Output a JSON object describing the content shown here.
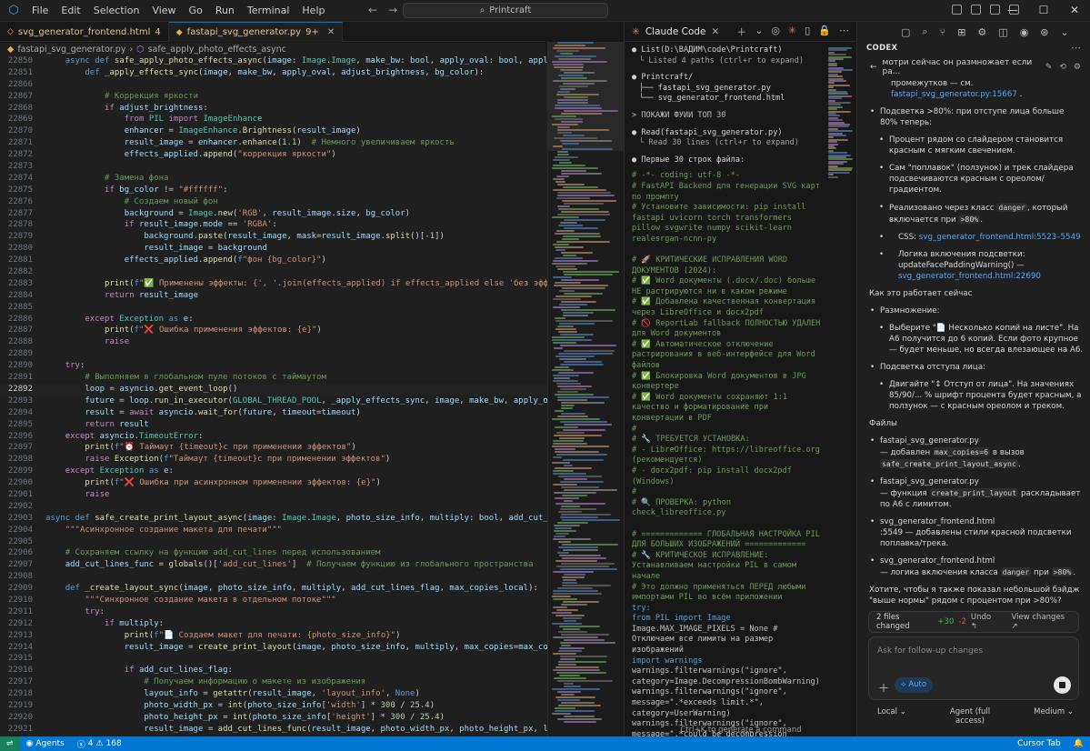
{
  "titlebar": {
    "menu": [
      "File",
      "Edit",
      "Selection",
      "View",
      "Go",
      "Run",
      "Terminal",
      "Help"
    ],
    "search": "Printcraft"
  },
  "editor": {
    "tabs": [
      {
        "label": "svg_generator_frontend.html",
        "badge": "4",
        "active": false
      },
      {
        "label": "fastapi_svg_generator.py",
        "badge": "9+",
        "active": true
      }
    ],
    "breadcrumb": {
      "file": "fastapi_svg_generator.py",
      "symbol": "safe_apply_photo_effects_async"
    }
  },
  "code_lines": [
    {
      "n": "22850",
      "t": "    async def safe_apply_photo_effects_async(image: Image.Image, make_bw: bool, apply_oval: bool, apply_b"
    },
    {
      "n": "22851",
      "t": "        def _apply_effects_sync(image, make_bw, apply_oval, adjust_brightness, bg_color):"
    },
    {
      "n": "22866",
      "t": ""
    },
    {
      "n": "22867",
      "t": "            # Коррекция яркости"
    },
    {
      "n": "22868",
      "t": "            if adjust_brightness:"
    },
    {
      "n": "22869",
      "t": "                from PIL import ImageEnhance"
    },
    {
      "n": "22870",
      "t": "                enhancer = ImageEnhance.Brightness(result_image)"
    },
    {
      "n": "22871",
      "t": "                result_image = enhancer.enhance(1.1)  # Немного увеличиваем яркость"
    },
    {
      "n": "22872",
      "t": "                effects_applied.append(\"коррекция яркости\")"
    },
    {
      "n": "22873",
      "t": ""
    },
    {
      "n": "22874",
      "t": "            # Замена фона"
    },
    {
      "n": "22875",
      "t": "            if bg_color != \"#ffffff\":"
    },
    {
      "n": "22876",
      "t": "                # Создаем новый фон"
    },
    {
      "n": "22877",
      "t": "                background = Image.new('RGB', result_image.size, bg_color)"
    },
    {
      "n": "22878",
      "t": "                if result_image.mode == 'RGBA':"
    },
    {
      "n": "22879",
      "t": "                    background.paste(result_image, mask=result_image.split()[-1])"
    },
    {
      "n": "22880",
      "t": "                    result_image = background"
    },
    {
      "n": "22881",
      "t": "                effects_applied.append(f\"фон {bg_color}\")"
    },
    {
      "n": "22882",
      "t": ""
    },
    {
      "n": "22883",
      "t": "            print(f\"✅ Применены эффекты: {', '.join(effects_applied) if effects_applied else 'без эффект"
    },
    {
      "n": "22884",
      "t": "            return result_image"
    },
    {
      "n": "22885",
      "t": ""
    },
    {
      "n": "22886",
      "t": "        except Exception as e:"
    },
    {
      "n": "22887",
      "t": "            print(f\"❌ Ошибка применения эффектов: {e}\")"
    },
    {
      "n": "22888",
      "t": "            raise"
    },
    {
      "n": "22889",
      "t": ""
    },
    {
      "n": "22890",
      "t": "    try:"
    },
    {
      "n": "22891",
      "t": "        # Выполняем в глобальном пуле потоков с таймаутом"
    },
    {
      "n": "22892",
      "t": "        loop = asyncio.get_event_loop()"
    },
    {
      "n": "22893",
      "t": "        future = loop.run_in_executor(GLOBAL_THREAD_POOL, _apply_effects_sync, image, make_bw, apply_ov"
    },
    {
      "n": "22894",
      "t": "        result = await asyncio.wait_for(future, timeout=timeout)"
    },
    {
      "n": "22895",
      "t": "        return result"
    },
    {
      "n": "22896",
      "t": "    except asyncio.TimeoutError:"
    },
    {
      "n": "22897",
      "t": "        print(f\"⏰ Таймаут {timeout}с при применении эффектов\")"
    },
    {
      "n": "22898",
      "t": "        raise Exception(f\"Таймаут {timeout}с при применении эффектов\")"
    },
    {
      "n": "22899",
      "t": "    except Exception as e:"
    },
    {
      "n": "22900",
      "t": "        print(f\"❌ Ошибка при асинхронном применении эффектов: {e}\")"
    },
    {
      "n": "22901",
      "t": "        raise"
    },
    {
      "n": "22902",
      "t": ""
    },
    {
      "n": "22903",
      "t": "async def safe_create_print_layout_async(image: Image.Image, photo_size_info, multiply: bool, add_cut_lin"
    },
    {
      "n": "22904",
      "t": "    \"\"\"Асинхронное создание макета для печати\"\"\""
    },
    {
      "n": "22905",
      "t": ""
    },
    {
      "n": "22906",
      "t": "    # Сохраняем ссылку на функцию add_cut_lines перед использованием"
    },
    {
      "n": "22907",
      "t": "    add_cut_lines_func = globals()['add_cut_lines']  # Получаем функцию из глобального пространства"
    },
    {
      "n": "22908",
      "t": ""
    },
    {
      "n": "22909",
      "t": "    def _create_layout_sync(image, photo_size_info, multiply, add_cut_lines_flag, max_copies_local):"
    },
    {
      "n": "22910",
      "t": "        \"\"\"Синхронное создание макета в отдельном потоке\"\"\""
    },
    {
      "n": "22911",
      "t": "        try:"
    },
    {
      "n": "22912",
      "t": "            if multiply:"
    },
    {
      "n": "22913",
      "t": "                print(f\"📄 Создаем макет для печати: {photo_size_info}\")"
    },
    {
      "n": "22914",
      "t": "                result_image = create_print_layout(image, photo_size_info, multiply, max_copies=max_copie"
    },
    {
      "n": "22915",
      "t": ""
    },
    {
      "n": "22916",
      "t": "                if add_cut_lines_flag:"
    },
    {
      "n": "22917",
      "t": "                    # Получаем информацию о макете из изображения"
    },
    {
      "n": "22918",
      "t": "                    layout_info = getattr(result_image, 'layout_info', None)"
    },
    {
      "n": "22919",
      "t": "                    photo_width_px = int(photo_size_info['width'] * 300 / 25.4)"
    },
    {
      "n": "22920",
      "t": "                    photo_height_px = int(photo_size_info['height'] * 300 / 25.4)"
    },
    {
      "n": "22921",
      "t": "                    result_image = add_cut_lines_func(result_image, photo_width_px, photo_height_px, layou"
    },
    {
      "n": "22922",
      "t": "                    "
    }
  ],
  "current_line": "22892",
  "claude": {
    "title": "Claude Code",
    "list_cmd": "List(D:\\ВАДИМ\\code\\Printcraft)",
    "list_result": "Listed 4 paths (ctrl+r to expand)",
    "tree": [
      "Printcraft/",
      "├── fastapi_svg_generator.py",
      "└── svg_generator_frontend.html"
    ],
    "prompt": "> ПОКАЖИ ФУИИ ТОП 30",
    "read_cmd": "Read(fastapi_svg_generator.py)",
    "read_result": "Read 30 lines (ctrl+r to expand)",
    "first_lines": "Первые 30 строк файла:",
    "code": [
      "# -*- coding: utf-8 -*-",
      "# FastAPI Backend для генерации SVG карт по промпту",
      "# Установите зависимости: pip install fastapi uvicorn torch transformers pillow svgwrite numpy scikit-learn realesrgan-ncnn-py",
      "",
      "# 🚀 КРИТИЧЕСКИЕ ИСПРАВЛЕНИЯ WORD ДОКУМЕНТОВ (2024):",
      "# ✅ Word документы (.docx/.doc) больше НЕ растрируются ни в каком режиме",
      "# ✅ Добавлена качественная конвертация через LibreOffice и docx2pdf",
      "# 🚫 ReportLab fallback ПОЛНОСТЬЮ УДАЛЕН для Word документов",
      "# ✅ Автоматическое отключение растрирования в веб-интерфейсе для Word файлов",
      "# ✅ Блокировка Word документов в JPG конвертере",
      "# ✅ Word документы сохраняют 1:1 качество и форматирование при конвертации в PDF",
      "#",
      "# 🔧 ТРЕБУЕТСЯ УСТАНОВКА:",
      "# - LibreOffice: https://libreoffice.org (рекомендуется)",
      "# - docx2pdf: pip install docx2pdf (Windows)",
      "#",
      "# 🔍 ПРОВЕРКА: python check_libreoffice.py",
      "",
      "# ============= ГЛОБАЛЬНАЯ НАСТРОЙКА PIL ДЛЯ БОЛЬШИХ ИЗОБРАЖЕНИЙ =============",
      "# 🔧 КРИТИЧЕСКОЕ ИСПРАВЛЕНИЕ: Устанавливаем настройки PIL в самом начале",
      "# Это должно применяться ПЕРЕД любыми импортами PIL во всём приложении",
      "try:",
      "    from PIL import Image",
      "    Image.MAX_IMAGE_PIXELS = None  # Отключаем все лимиты на размер изображений",
      "    import warnings",
      "    warnings.filterwarnings(\"ignore\", category=Image.DecompressionBombWarning)",
      "    warnings.filterwarnings(\"ignore\", message=\".*exceeds limit.*\", category=UserWarning)",
      "    warnings.filterwarnings(\"ignore\", message=\".*could be decompression bomb.*\", category=UserWarning)"
    ],
    "hint": "Ctrl+K to generate a command"
  },
  "codex": {
    "title": "CODEX",
    "thread": "мотри сейчас он размножает если ра...",
    "intro1": "промежутков — см.",
    "intro1_link": "fastapi_svg_generator.py:15667",
    "b1": "Подсветка >80%: при отступе лица больше 80% теперь:",
    "b1a": "Процент рядом со слайдером становится красным с мягким свечением.",
    "b1b": "Сам \"поплавок\" (ползунок) и трек слайдера подсвечиваются красным с ореолом/градиентом.",
    "b1c_pre": "Реализовано через класс",
    "b1c_code": "danger",
    "b1c_mid": ", который включается при",
    "b1c_code2": ">80%",
    "b1d_pre": "CSS:",
    "b1d_link": "svg_generator_frontend.html:5523–5549",
    "b1e_pre": "Логика включения подсветки:",
    "b1e_code": "updateFacePaddingWarning()",
    "b1e_link": "svg_generator_frontend.html:22690",
    "how": "Как это работает сейчас",
    "m1": "Размножение:",
    "m1a": "Выберите \"📄 Несколько копий на листе\". На А6 получится до 6 копий. Если фото крупное — будет меньше, но всегда влезающее на А6.",
    "m2": "Подсветка отступа лица:",
    "m2a": "Двигайте \"↕ Отступ от лица\". На значениях 85/90/... % шрифт процента будет красным, а ползунок — с красным ореолом и треком.",
    "files": "Файлы",
    "f1": "fastapi_svg_generator.py",
    "f1d_pre": "— добавлен",
    "f1d_code": "max_copies=6",
    "f1d_mid": "в вызов",
    "f1d_code2": "safe_create_print_layout_async",
    "f2": "fastapi_svg_generator.py",
    "f2d_pre": "— функция",
    "f2d_code": "create_print_layout",
    "f2d_post": "раскладывает по А6 с лимитом.",
    "f3": "svg_generator_frontend.html",
    "f3d": ":5549 — добавлены стили красной подсветки поплавка/трека.",
    "f4": "svg_generator_frontend.html",
    "f4d_pre": "— логика включения класса",
    "f4d_code": "danger",
    "f4d_mid": "при",
    "f4d_code2": ">80%",
    "question": "Хотите, чтобы я также показал небольшой бэйдж \"выше нормы\" рядом с процентом при >80%?",
    "changes": "2 files changed",
    "added": "+30",
    "removed": "-2",
    "undo": "Undo ↰",
    "review": "View changes ↗",
    "placeholder": "Ask for follow-up changes",
    "auto": "⟡ Auto",
    "footer_local": "Local ⌄",
    "footer_agent": "Agent (full access)",
    "footer_medium": "Medium ⌄"
  },
  "status": {
    "agents": "Agents",
    "errors": "4",
    "warnings": "168",
    "right": "Cursor Tab"
  }
}
